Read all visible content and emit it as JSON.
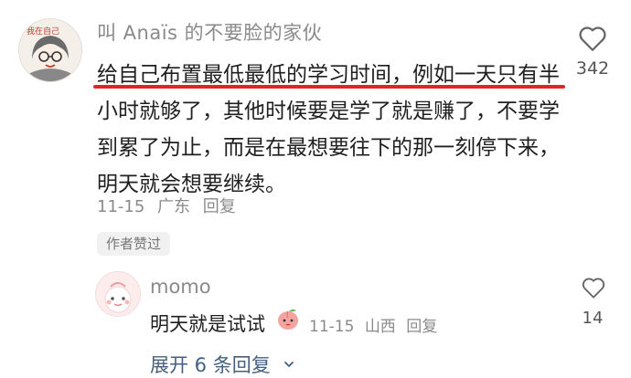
{
  "comment": {
    "username": "叫 Anaïs 的不要脸的家伙",
    "text": "给自己布置最低最低的学习时间，例如一天只有半小时就够了，其他时候要是学了就是赚了，不要学到累了为止，而是在最想要往下的那一刻停下来，明天就会想要继续。",
    "date": "11-15",
    "location": "广东",
    "reply_label": "回复",
    "badge": "作者赞过",
    "likes": "342",
    "avatar_text": "我在自己"
  },
  "reply": {
    "username": "momo",
    "text": "明天就是试试",
    "date": "11-15",
    "location": "山西",
    "reply_label": "回复",
    "likes": "14"
  },
  "expand_label": "展开 6 条回复",
  "colors": {
    "highlight": "#e0242d",
    "meta_gray": "#8a8a8a",
    "link_blue": "#45607f"
  },
  "icons": {
    "like": "heart-outline-icon",
    "emoji": "peach-emoji-icon",
    "expand": "chevron-down-icon"
  }
}
